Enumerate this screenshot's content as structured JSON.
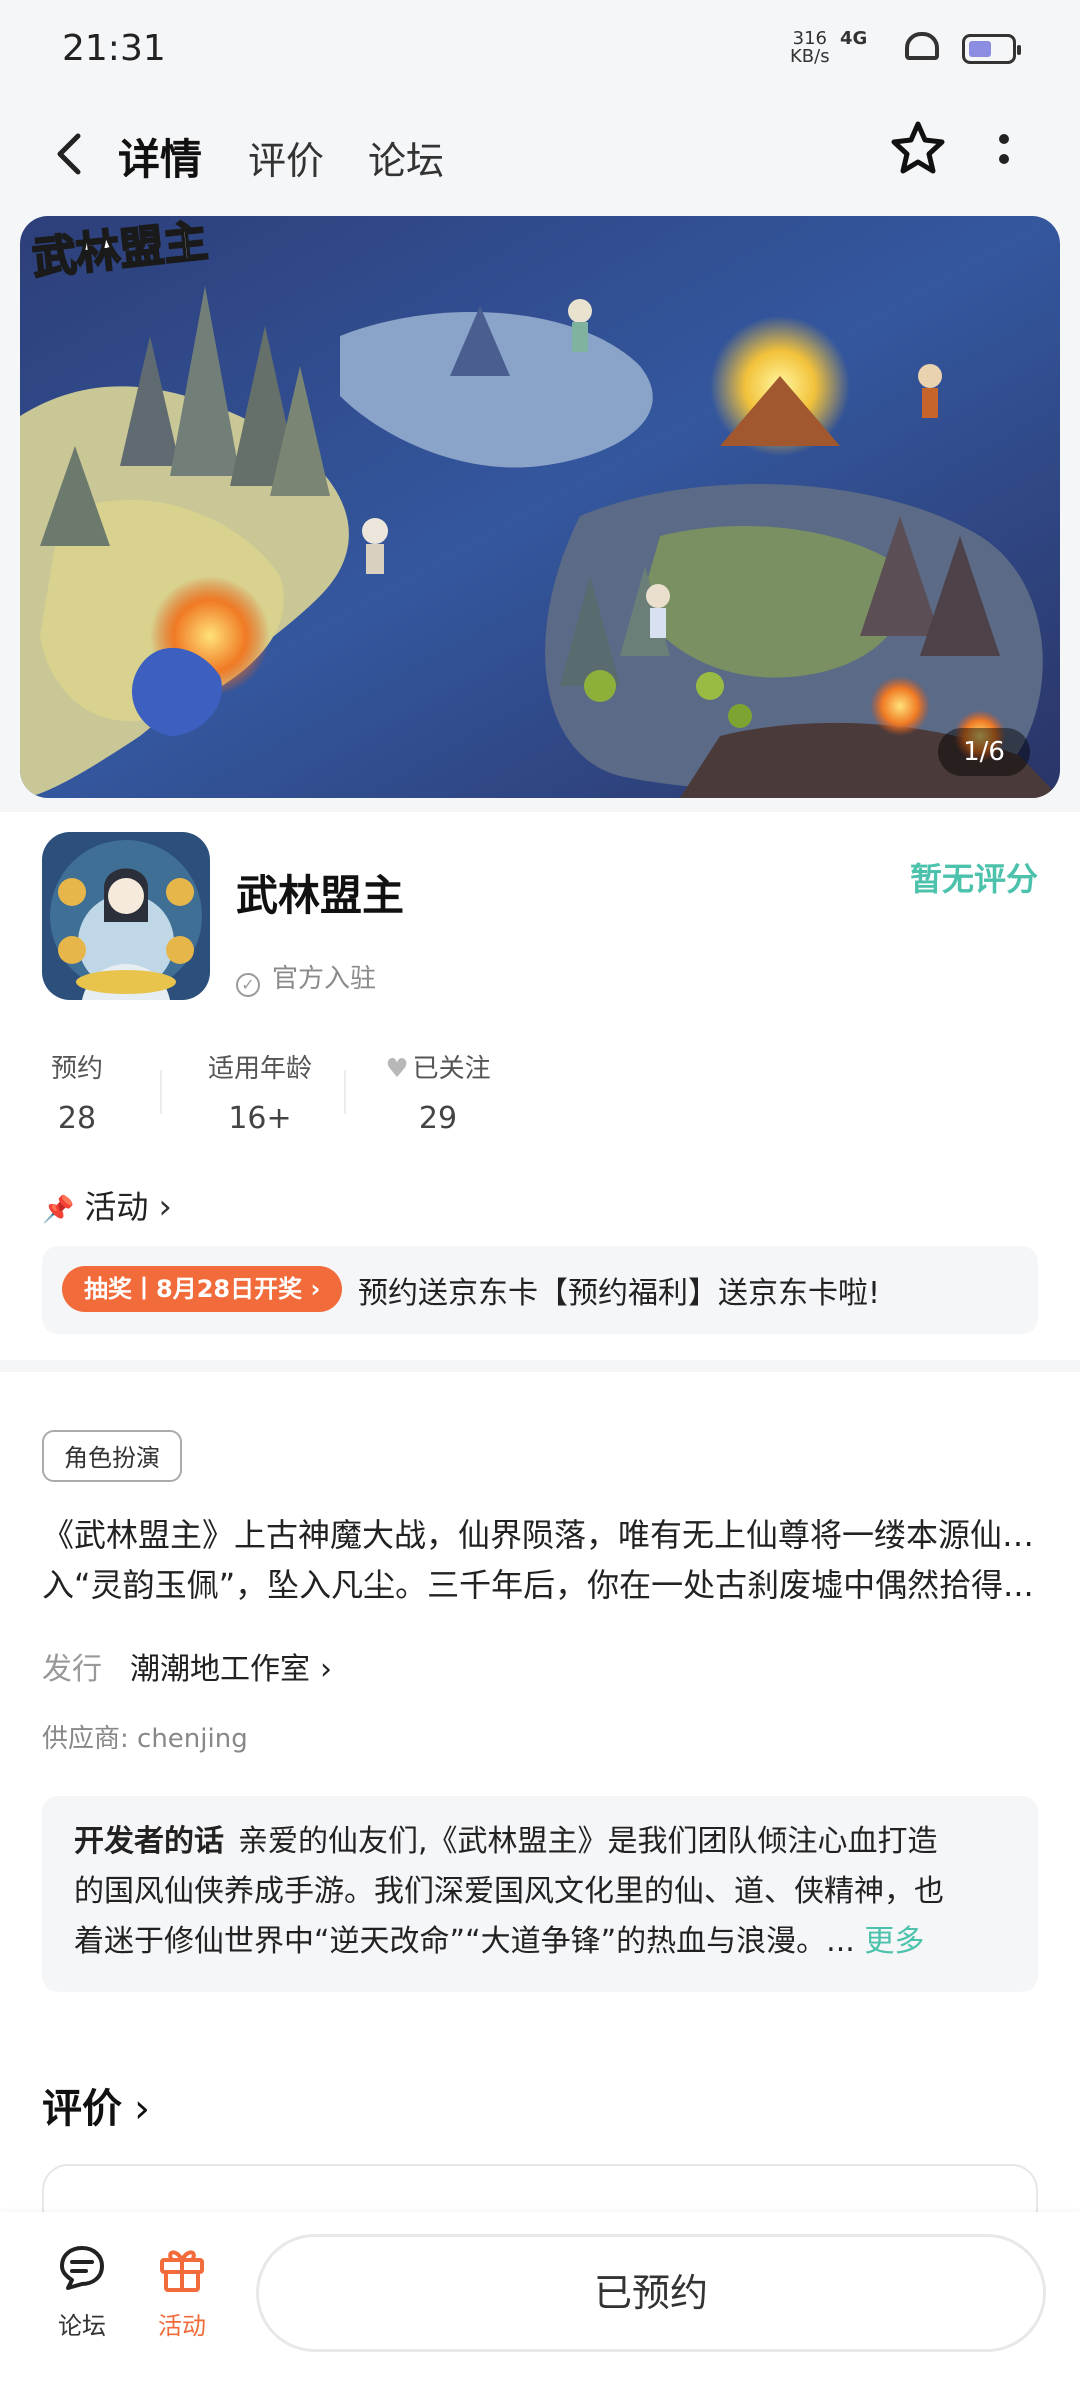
{
  "status_bar": {
    "time": "21:31",
    "net_speed_value": "316",
    "net_speed_unit": "KB/s",
    "signal": "4G"
  },
  "header": {
    "tabs": [
      {
        "label": "详情",
        "active": true
      },
      {
        "label": "评价",
        "active": false
      },
      {
        "label": "论坛",
        "active": false
      }
    ],
    "back_icon": "chevron-left-icon",
    "favorite_icon": "star-icon",
    "more_icon": "more-vertical-icon"
  },
  "banner": {
    "logo_text": "武林盟主",
    "counter": "1/6"
  },
  "game": {
    "title": "武林盟主",
    "official_label": "官方入驻",
    "rating_text": "暂无评分"
  },
  "stats": [
    {
      "label": "预约",
      "value": "28"
    },
    {
      "label": "适用年龄",
      "value": "16+"
    },
    {
      "label": "已关注",
      "value": "29"
    }
  ],
  "activity": {
    "heading": "活动",
    "badge": "抽奖丨8月28日开奖",
    "text": "预约送京东卡【预约福利】送京东卡啦!"
  },
  "details": {
    "genre_tag": "角色扮演",
    "description_lines": [
      "《武林盟主》上古神魔大战，仙界陨落，唯有无上仙尊将一缕本源仙魂封",
      "入“灵韵玉佩”，坠入凡尘。三千年后，你在一处古刹废墟中偶然拾得..."
    ],
    "publisher_label": "发行",
    "publisher_name": "潮潮地工作室",
    "supplier": "供应商: chenjing"
  },
  "developer_note": {
    "title": "开发者的话",
    "lines": [
      "亲爱的仙友们,《武林盟主》是我们团队倾注心血打造",
      "的国风仙侠养成手游。我们深爱国风文化里的仙、道、侠精神，也",
      "着迷于修仙世界中“逆天改命”“大道争锋”的热血与浪漫。..."
    ],
    "more": "更多"
  },
  "reviews": {
    "heading": "评价"
  },
  "bottom_bar": {
    "forum_label": "论坛",
    "activity_label": "活动",
    "reserved_button": "已预约"
  },
  "colors": {
    "accent_teal": "#3fd0b6",
    "rating_teal": "#4cc1ab",
    "activity_orange": "#f26b3a"
  }
}
